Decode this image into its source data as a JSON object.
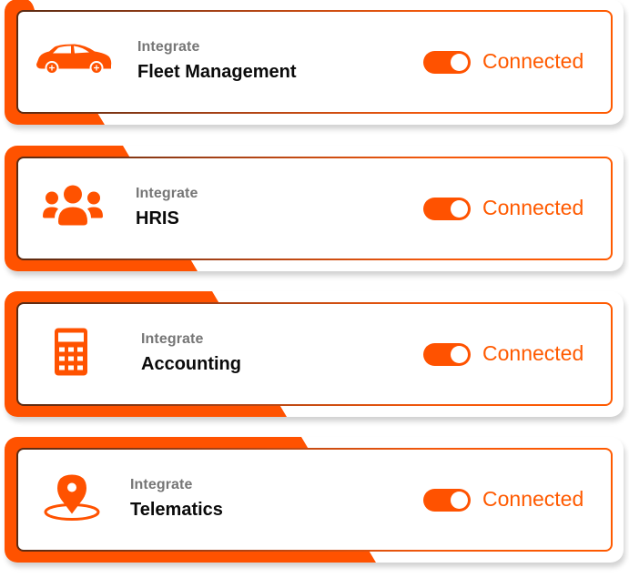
{
  "accent_color": "#ff5200",
  "integrations": [
    {
      "eyebrow": "Integrate",
      "title": "Fleet Management",
      "icon": "car-icon",
      "toggle_on": true,
      "status": "Connected"
    },
    {
      "eyebrow": "Integrate",
      "title": "HRIS",
      "icon": "users-group-icon",
      "toggle_on": true,
      "status": "Connected"
    },
    {
      "eyebrow": "Integrate",
      "title": "Accounting",
      "icon": "calculator-icon",
      "toggle_on": true,
      "status": "Connected"
    },
    {
      "eyebrow": "Integrate",
      "title": "Telematics",
      "icon": "location-pin-icon",
      "toggle_on": true,
      "status": "Connected"
    }
  ]
}
